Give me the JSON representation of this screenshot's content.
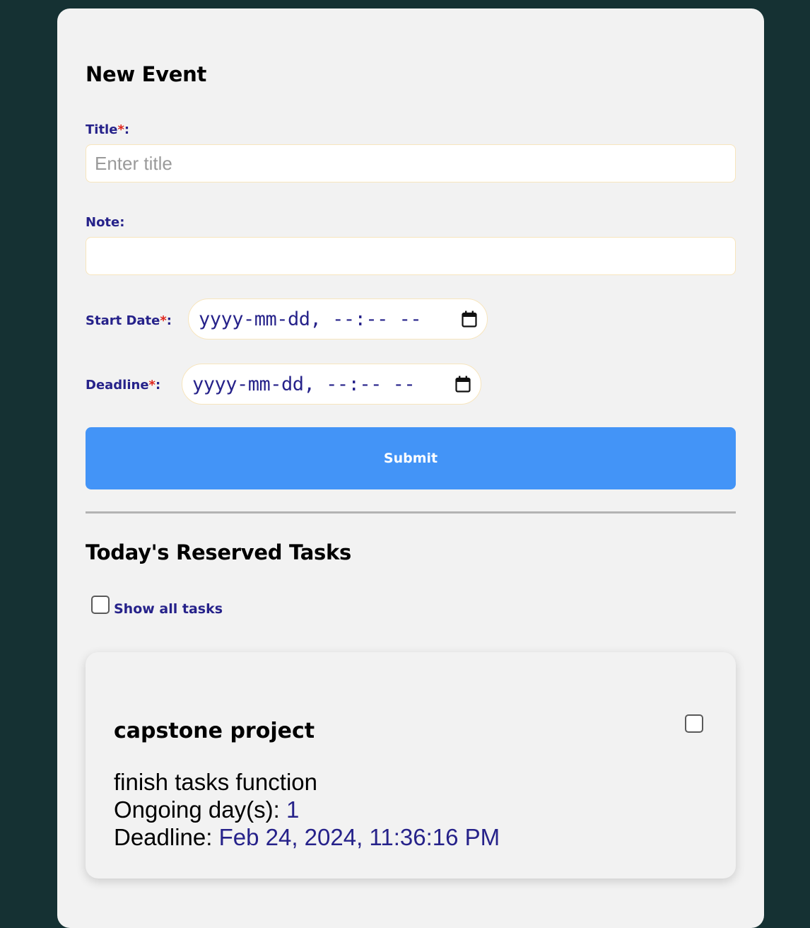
{
  "form": {
    "title": "New Event",
    "title_label": "Title",
    "title_placeholder": "Enter title",
    "title_value": "",
    "note_label": "Note:",
    "note_value": "",
    "start_label": "Start Date",
    "start_value": "yyyy-mm-dd, --:-- --",
    "deadline_label": "Deadline",
    "deadline_value": "yyyy-mm-dd, --:-- --",
    "required_mark": "*",
    "colon": ":",
    "submit_label": "Submit"
  },
  "tasks": {
    "title": "Today's Reserved Tasks",
    "show_all_label": "Show all tasks",
    "show_all_checked": false,
    "items": [
      {
        "name": "capstone project",
        "note": "finish tasks function",
        "ongoing_label": "Ongoing day(s): ",
        "ongoing_value": "1",
        "deadline_label": "Deadline: ",
        "deadline_value": "Feb 24, 2024, 11:36:16 PM",
        "checked": false
      }
    ]
  },
  "icons": {
    "calendar": "calendar-icon"
  },
  "colors": {
    "background": "#153133",
    "panel": "#f2f2f2",
    "label": "#26228a",
    "required": "#e0251b",
    "submit": "#4394f7",
    "input_border": "#f7e5bd"
  }
}
